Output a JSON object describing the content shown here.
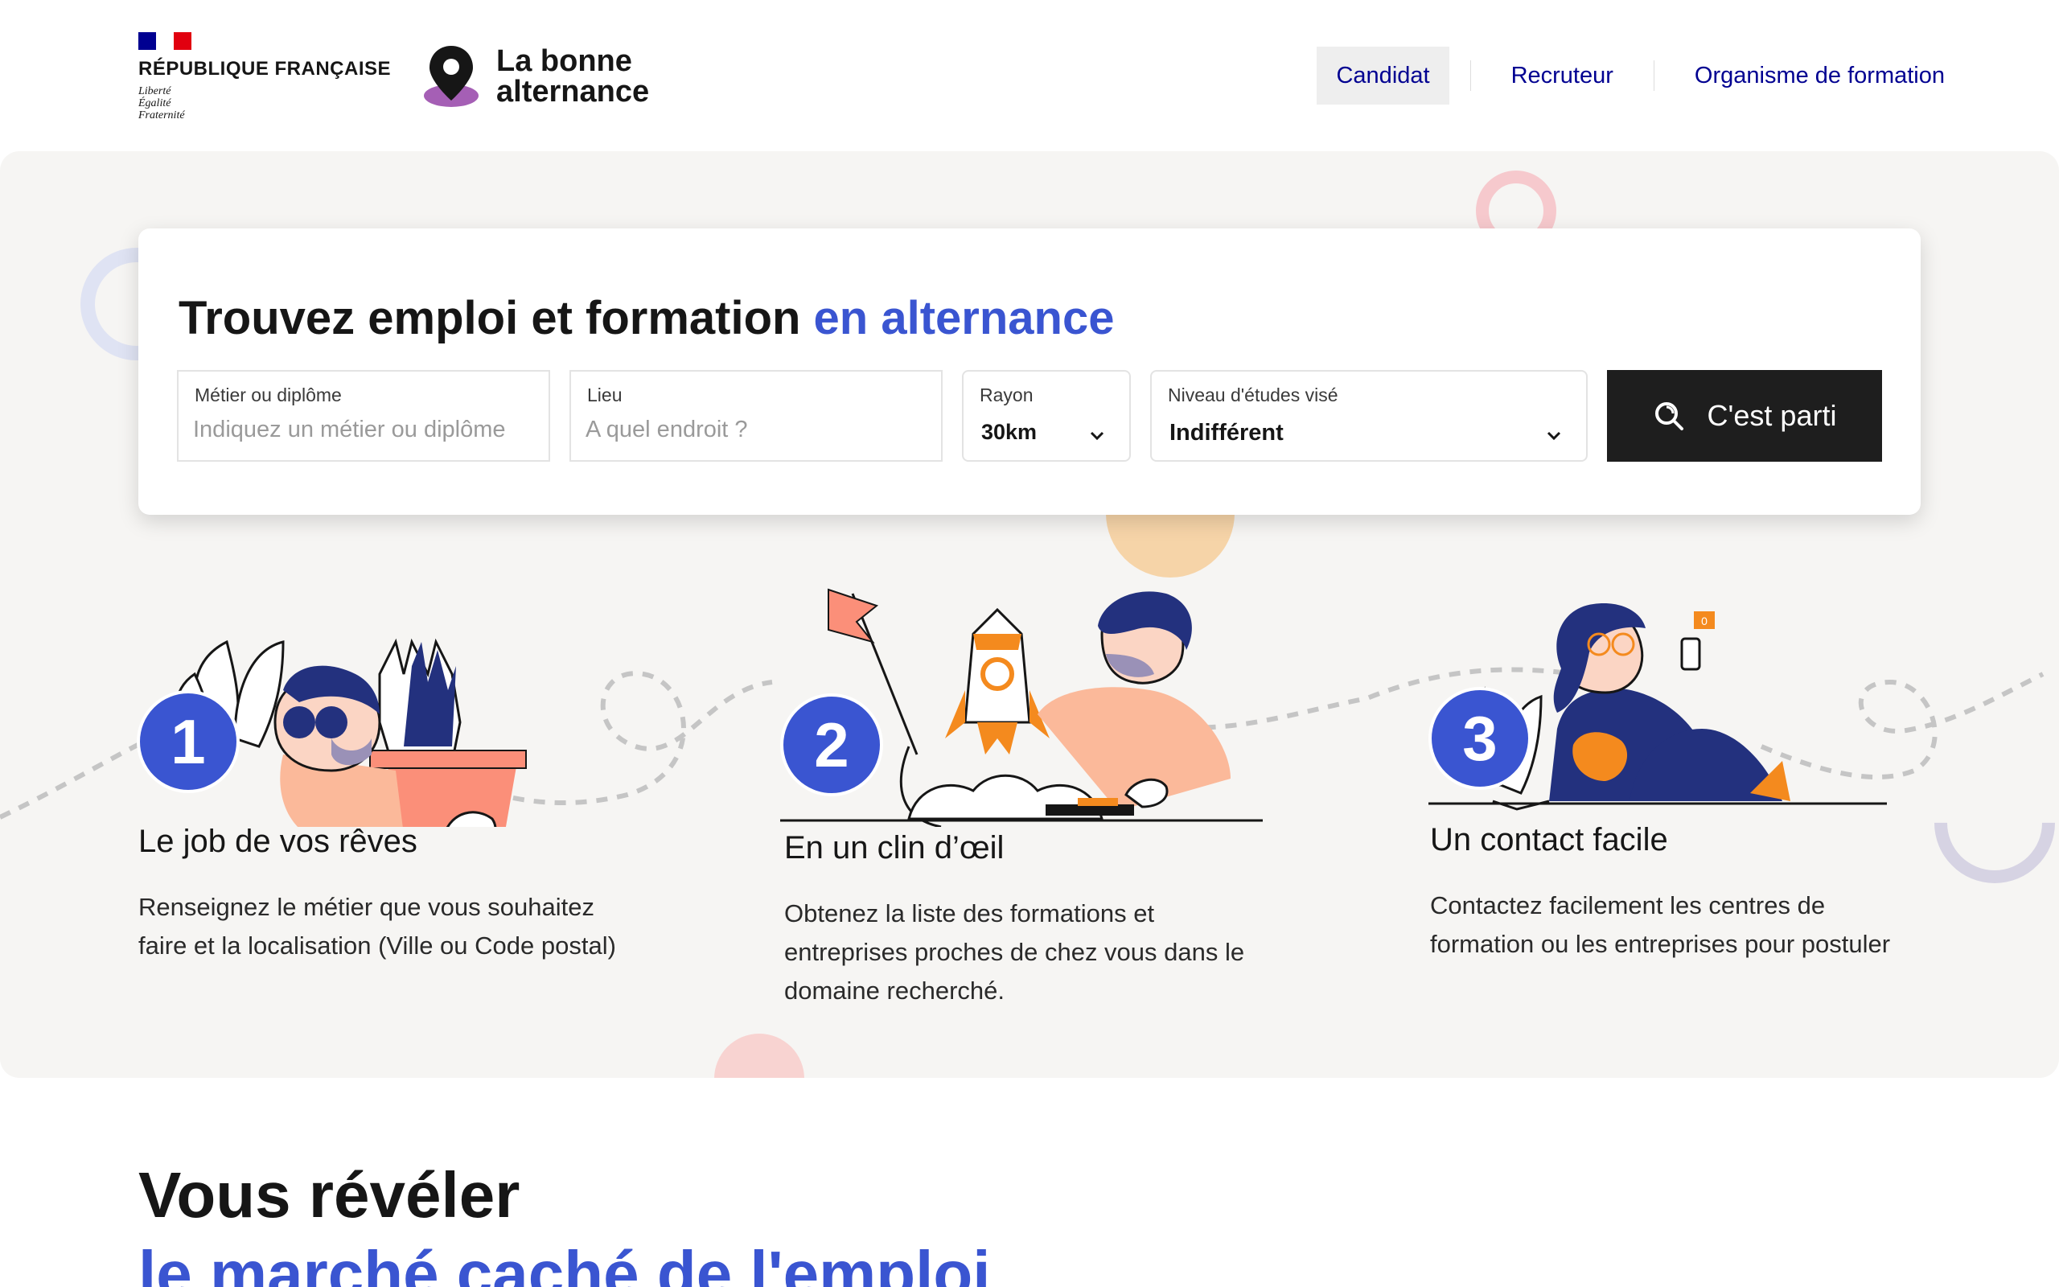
{
  "header": {
    "republique": {
      "name": "RÉPUBLIQUE FRANÇAISE",
      "motto": [
        "Liberté",
        "Égalité",
        "Fraternité"
      ]
    },
    "brand": {
      "line1": "La bonne",
      "line2": "alternance"
    },
    "nav": [
      {
        "label": "Candidat",
        "active": true
      },
      {
        "label": "Recruteur",
        "active": false
      },
      {
        "label": "Organisme de formation",
        "active": false
      }
    ]
  },
  "search": {
    "title_main": "Trouvez emploi et formation ",
    "title_accent": "en alternance",
    "job": {
      "label": "Métier ou diplôme",
      "placeholder": "Indiquez un métier ou diplôme",
      "value": ""
    },
    "place": {
      "label": "Lieu",
      "placeholder": "A quel endroit ?",
      "value": ""
    },
    "radius": {
      "label": "Rayon",
      "value": "30km"
    },
    "level": {
      "label": "Niveau d'études visé",
      "value": "Indifférent"
    },
    "submit_label": "C'est parti"
  },
  "steps": [
    {
      "number": "1",
      "title": "Le job de vos rêves",
      "desc": "Renseignez le métier que vous souhaitez faire et la localisation (Ville ou Code postal)"
    },
    {
      "number": "2",
      "title": "En un clin d’œil",
      "desc": "Obtenez la liste des formations et entreprises proches de chez vous dans le domaine recherché."
    },
    {
      "number": "3",
      "title": "Un contact facile",
      "desc": "Contactez facilement les centres de formation ou les entreprises pour postuler"
    }
  ],
  "illustration": {
    "notification_count": "0"
  },
  "bottom": {
    "title": "Vous révéler",
    "subtitle": "le marché caché de l'emploi"
  },
  "colors": {
    "accent": "#3a55d1",
    "nav_text": "#000091",
    "hero_bg": "#f6f5f3",
    "button_bg": "#1e1e1e",
    "illustration_orange": "#f48a1e",
    "illustration_navy": "#23317e",
    "illustration_peach": "#fbb99a"
  },
  "icons": [
    "marianne-flag-icon",
    "location-pin-icon",
    "chevron-down-icon",
    "search-icon"
  ]
}
